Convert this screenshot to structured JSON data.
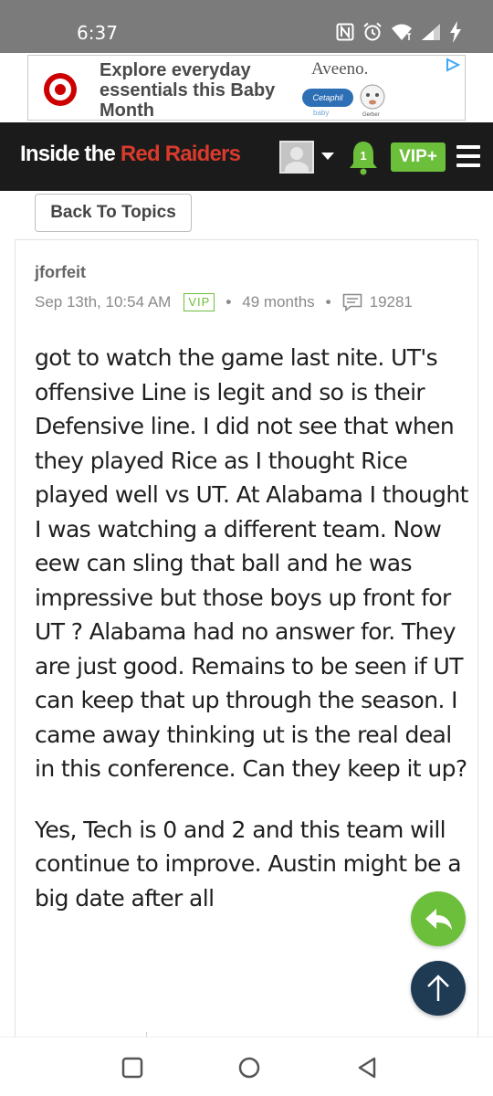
{
  "status_bar": {
    "time": "6:37",
    "icons": [
      "nfc-icon",
      "alarm-icon",
      "wifi-icon",
      "cell-signal-icon",
      "charging-icon"
    ]
  },
  "ad": {
    "headline": "Explore everyday essentials this Baby Month",
    "brand_aveeno": "Aveeno.",
    "brand_cetaphil": "Cetaphil",
    "brand_cetaphil_sub": "baby",
    "brand_gerber": "Gerber"
  },
  "header": {
    "logo_prefix": "Inside the ",
    "logo_accent": "Red Raiders",
    "notification_count": "1",
    "vip_label": "VIP+",
    "colors": {
      "background": "#1b1b1b",
      "accent": "#d83a2c",
      "vip": "#6cbf3a"
    }
  },
  "back_button": {
    "label": "Back To Topics"
  },
  "post": {
    "author": "jforfeit",
    "date": "Sep 13th, 10:54 AM",
    "badge": "VIP",
    "separator": "•",
    "tenure": "49 months",
    "post_count": "19281",
    "body_paragraphs": [
      "got to watch the game last nite. UT's offensive Line is legit and so is their Defensive line. I did not see that when they played Rice as I thought Rice played well vs UT. At Alabama I thought I was watching a different team. Now eew can sling that ball and he was impressive but those boys up front for UT ? Alabama had no answer for. They are just good. Remains to be seen if UT can keep that up through the season. I came away thinking ut is the real deal in this conference. Can they keep it up?",
      "Yes, Tech is 0 and 2 and this team will continue to improve. Austin might be a big date after all"
    ]
  },
  "fabs": {
    "reply": "reply-icon",
    "scroll_top": "arrow-up-icon"
  },
  "nav_bar": {
    "buttons": [
      "recents-button",
      "home-button",
      "back-button"
    ]
  }
}
